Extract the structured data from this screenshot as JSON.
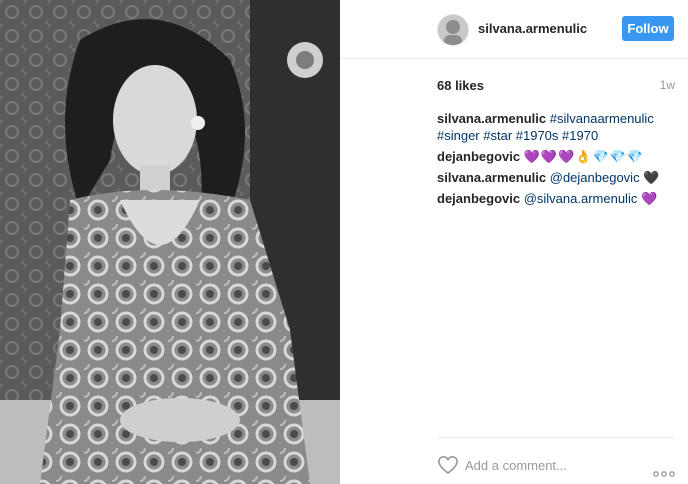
{
  "post": {
    "username": "silvana.armenulic",
    "follow_label": "Follow",
    "likes": "68 likes",
    "time": "1w",
    "comments": [
      {
        "author": "silvana.armenulic",
        "text": "#silvanaarmenulic #singer #star #1970s #1970",
        "emoji": ""
      },
      {
        "author": "dejanbegovic",
        "text": "",
        "emoji": "💜💜💜👌💎💎💎"
      },
      {
        "author": "silvana.armenulic",
        "text": "@dejanbegovic",
        "emoji": "🖤"
      },
      {
        "author": "dejanbegovic",
        "text": "@silvana.armenulic",
        "emoji": "💜"
      }
    ],
    "add_comment_placeholder": "Add a comment..."
  },
  "icons": {
    "like": "heart-outline-icon",
    "options": "more-options-icon"
  },
  "colors": {
    "follow_button": "#3897f0",
    "link": "#003569",
    "muted": "#999999"
  }
}
